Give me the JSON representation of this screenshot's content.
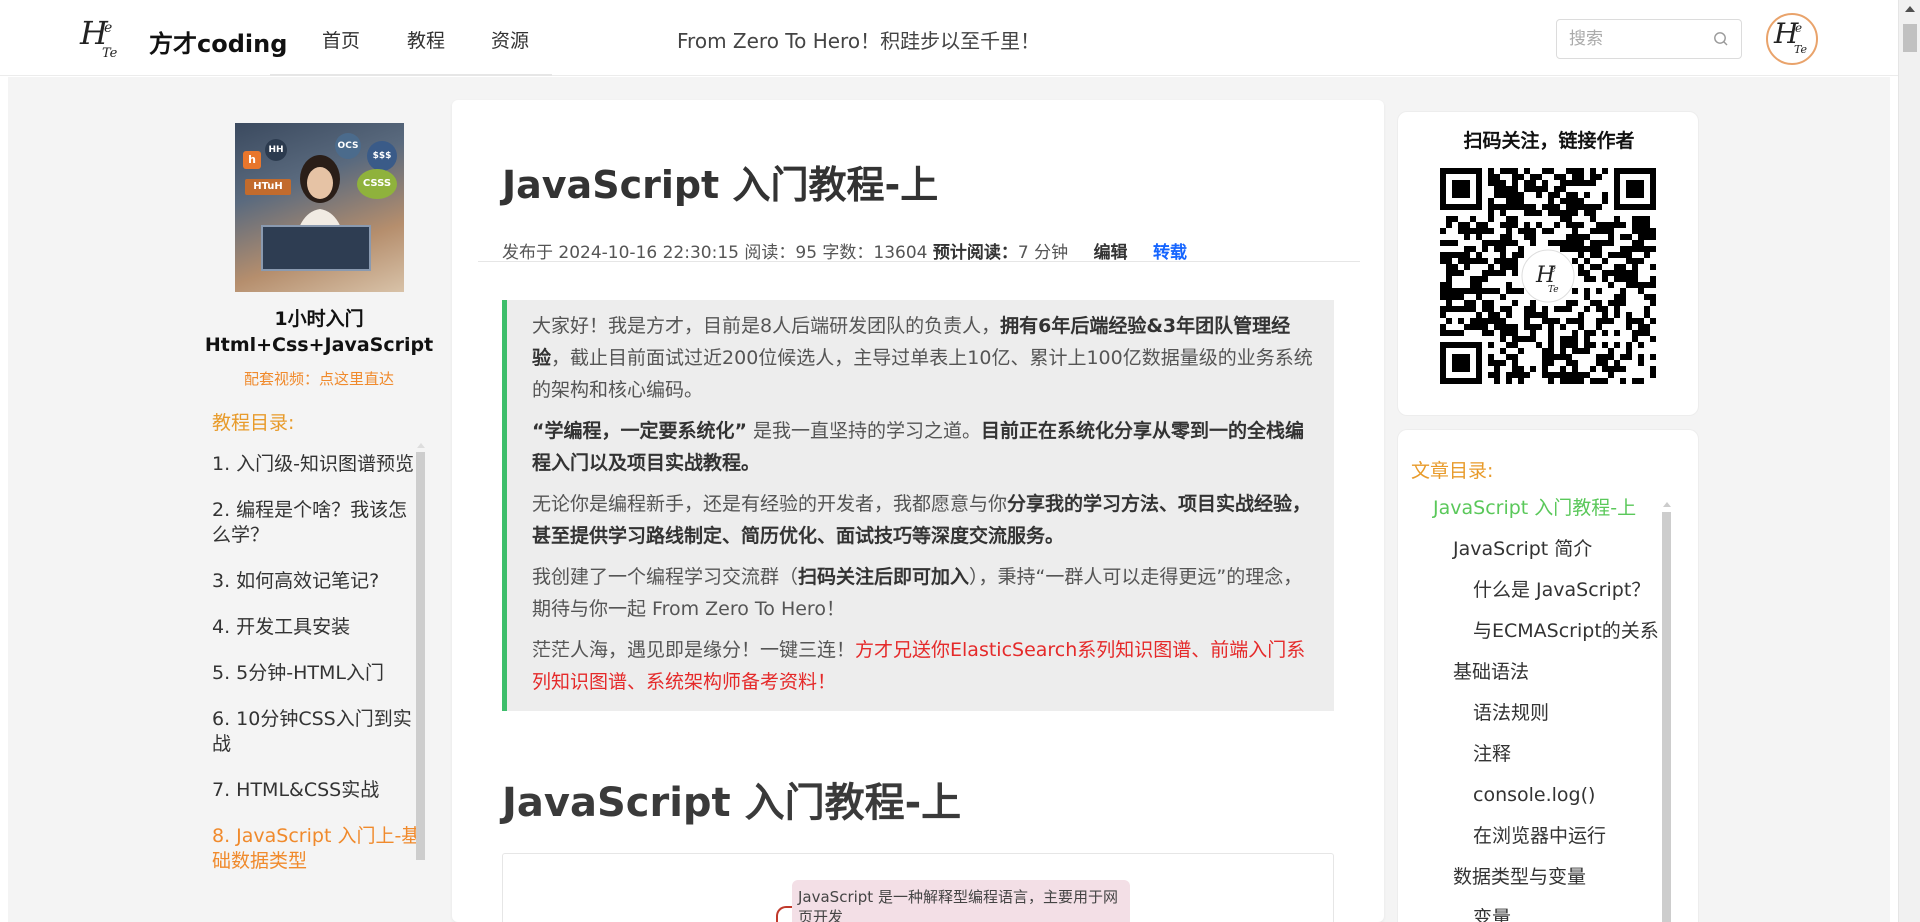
{
  "header": {
    "brand": "方才coding",
    "nav": [
      "首页",
      "教程",
      "资源"
    ],
    "slogan": "From Zero To Hero！积跬步以至千里！",
    "search_placeholder": "搜索",
    "icons": {
      "search": "search-icon",
      "logo": "hero-logo",
      "avatar": "user-avatar"
    }
  },
  "left_sidebar": {
    "course_title_line1": "1小时入门",
    "course_title_line2": "Html+Css+JavaScript",
    "video_link": "配套视频：点这里直达",
    "toc_heading": "教程目录:",
    "items": [
      {
        "label": "1. 入门级-知识图谱预览",
        "active": false
      },
      {
        "label": "2. 编程是个啥？我该怎么学？",
        "active": false
      },
      {
        "label": "3. 如何高效记笔记?",
        "active": false
      },
      {
        "label": "4. 开发工具安装",
        "active": false
      },
      {
        "label": "5. 5分钟-HTML入门",
        "active": false
      },
      {
        "label": "6. 10分钟CSS入门到实战",
        "active": false
      },
      {
        "label": "7. HTML&CSS实战",
        "active": false
      },
      {
        "label": "8. JavaScript 入门上-基础数据类型",
        "active": true
      }
    ]
  },
  "article": {
    "title": "JavaScript 入门教程-上",
    "meta": {
      "published_label": "发布于",
      "published": "2024-10-16 22:30:15",
      "reads_label": "阅读：",
      "reads": "95",
      "words_label": "字数：",
      "words": "13604",
      "est_label": "预计阅读：",
      "est": "7 分钟",
      "edit": "编辑",
      "repost": "转载"
    },
    "intro": {
      "p1_a": "大家好！我是方才，目前是8人后端研发团队的负责人，",
      "p1_b": "拥有6年后端经验&3年团队管理经验",
      "p1_c": "，截止目前面试过近200位候选人，主导过单表上10亿、累计上100亿数据量级的业务系统的架构和核心编码。",
      "p2_a": "“学编程，一定要系统化”",
      "p2_b": " 是我一直坚持的学习之道。",
      "p2_c": "目前正在系统化分享从零到一的全栈编程入门以及项目实战教程。",
      "p3_a": "无论你是编程新手，还是有经验的开发者，我都愿意与你",
      "p3_b": "分享我的学习方法、项目实战经验，甚至提供学习路线制定、简历优化、面试技巧等深度交流服务。",
      "p4_a": "我创建了一个编程学习交流群（",
      "p4_b": "扫码关注后即可加入",
      "p4_c": "），秉持“一群人可以走得更远”的理念，期待与你一起 From Zero To Hero！",
      "p5_a": "茫茫人海，遇见即是缘分！一键三连！",
      "p5_b": "方才兄送你ElasticSearch系列知识图谱、前端入门系列知识图谱、系统架构师备考资料！"
    },
    "h2": "JavaScript 入门教程-上",
    "mindmap_node": "JavaScript 是一种解释型编程语言，主要用于网页开发"
  },
  "right_sidebar": {
    "qr_title": "扫码关注，链接作者",
    "toc_heading": "文章目录:",
    "toc": [
      {
        "label": "JavaScript 入门教程-上",
        "level": 1,
        "active": true
      },
      {
        "label": "JavaScript 简介",
        "level": 2,
        "active": false
      },
      {
        "label": "什么是 JavaScript？",
        "level": 3,
        "active": false
      },
      {
        "label": "与ECMAScript的关系",
        "level": 3,
        "active": false
      },
      {
        "label": "基础语法",
        "level": 2,
        "active": false
      },
      {
        "label": "语法规则",
        "level": 3,
        "active": false
      },
      {
        "label": "注释",
        "level": 3,
        "active": false
      },
      {
        "label": "console.log()",
        "level": 3,
        "active": false
      },
      {
        "label": "在浏览器中运行",
        "level": 3,
        "active": false
      },
      {
        "label": "数据类型与变量",
        "level": 2,
        "active": false
      },
      {
        "label": "变量",
        "level": 3,
        "active": false
      }
    ]
  },
  "colors": {
    "accent_orange": "#f08a2c",
    "toc_heading": "#e89b2b",
    "active_green": "#5ac85a",
    "repost_blue": "#1565ff",
    "quote_border": "#3dbe6b",
    "highlight_red": "#e52a2a"
  }
}
